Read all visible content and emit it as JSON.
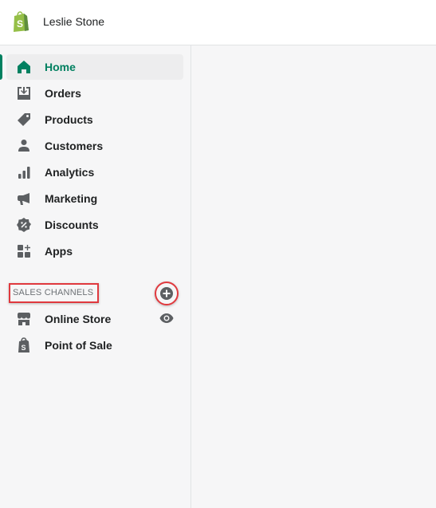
{
  "header": {
    "store_name": "Leslie Stone"
  },
  "colors": {
    "accent": "#008060",
    "logo": "#95bf47",
    "highlight": "#e0393e",
    "icon": "#5c5f62"
  },
  "sidebar": {
    "items": [
      {
        "label": "Home",
        "icon": "home-icon",
        "active": true
      },
      {
        "label": "Orders",
        "icon": "orders-icon"
      },
      {
        "label": "Products",
        "icon": "tag-icon"
      },
      {
        "label": "Customers",
        "icon": "person-icon"
      },
      {
        "label": "Analytics",
        "icon": "bar-chart-icon"
      },
      {
        "label": "Marketing",
        "icon": "megaphone-icon"
      },
      {
        "label": "Discounts",
        "icon": "discount-icon"
      },
      {
        "label": "Apps",
        "icon": "apps-icon"
      }
    ],
    "sales_channels": {
      "label": "SALES CHANNELS",
      "items": [
        {
          "label": "Online Store",
          "icon": "store-icon"
        },
        {
          "label": "Point of Sale",
          "icon": "shopping-bag-icon"
        }
      ]
    }
  }
}
